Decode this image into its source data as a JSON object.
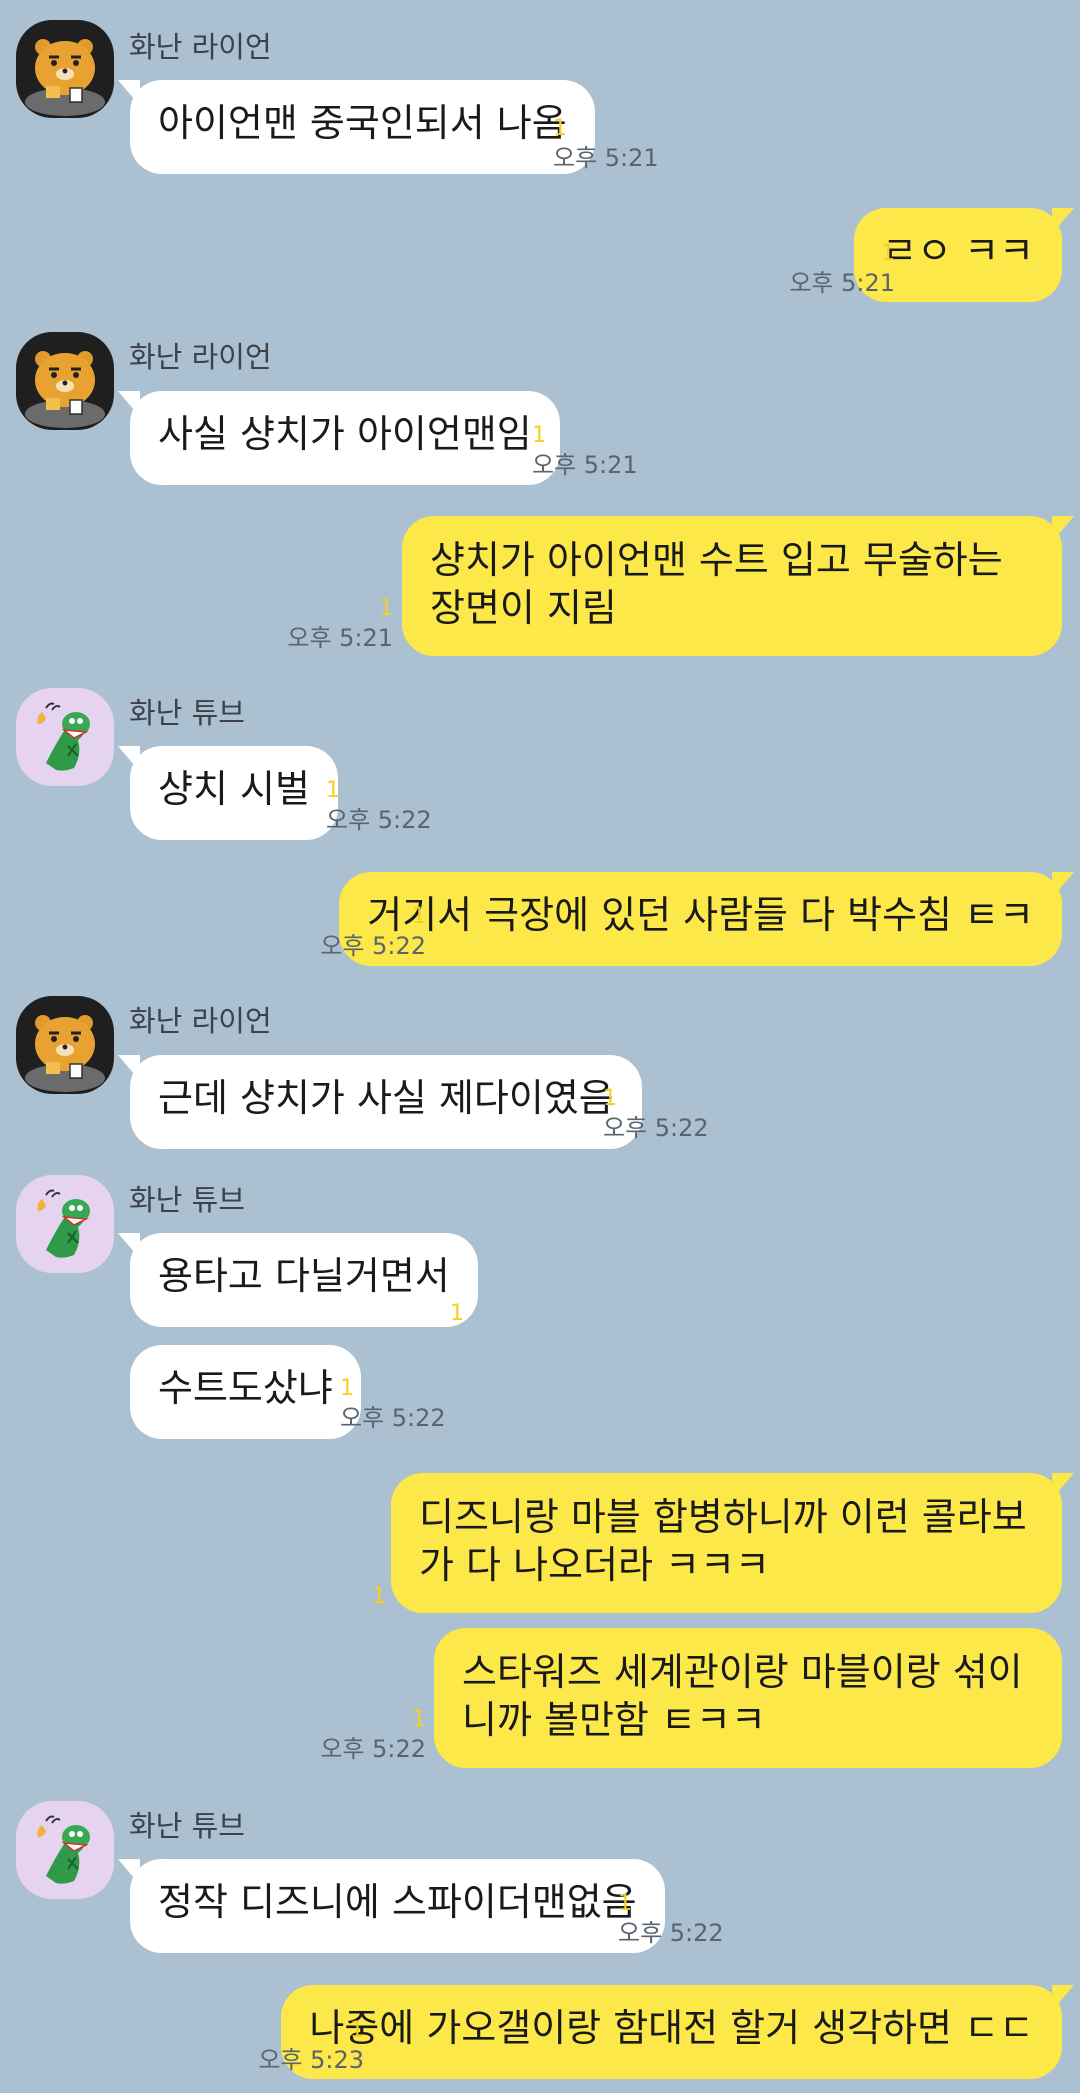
{
  "senders": {
    "ryan": "화난 라이언",
    "tube": "화난 튜브"
  },
  "messages": [
    {
      "text": "아이언맨 중국인되서 나옴",
      "unread": "1",
      "time": "오후 5:21"
    },
    {
      "text": "ㄹㅇ ㅋㅋ",
      "unread": "1",
      "time": "오후 5:21"
    },
    {
      "text": "사실 샹치가 아이언맨임",
      "unread": "1",
      "time": "오후 5:21"
    },
    {
      "text": "샹치가 아이언맨 수트 입고 무술하는 장면이 지림",
      "unread": "1",
      "time": "오후 5:21"
    },
    {
      "text": "샹치 시벌",
      "unread": "1",
      "time": "오후 5:22"
    },
    {
      "text": "거기서 극장에 있던 사람들 다 박수침 ㅌㅋ",
      "unread": "1",
      "time": "오후 5:22"
    },
    {
      "text": "근데 샹치가 사실 제다이였음",
      "unread": "1",
      "time": "오후 5:22"
    },
    {
      "text": "용타고 다닐거면서",
      "unread": "1",
      "time": ""
    },
    {
      "text": "수트도샀냐",
      "unread": "1",
      "time": "오후 5:22"
    },
    {
      "text": "디즈니랑 마블 합병하니까 이런 콜라보가 다 나오더라 ㅋㅋㅋ",
      "unread": "1",
      "time": ""
    },
    {
      "text": "스타워즈 세계관이랑 마블이랑 섞이니까 볼만함 ㅌㅋㅋ",
      "unread": "1",
      "time": "오후 5:22"
    },
    {
      "text": "정작 디즈니에 스파이더맨없음",
      "unread": "1",
      "time": "오후 5:22"
    },
    {
      "text": "나중에 가오갤이랑 함대전 할거 생각하면 ㄷㄷ",
      "unread": "1",
      "time": "오후 5:23"
    }
  ],
  "colors": {
    "background": "#abc1d1",
    "incoming_bubble": "#ffffff",
    "outgoing_bubble": "#fde84a",
    "unread_count": "#f6d01e"
  },
  "icons": {
    "ryan_avatar": "lion-character-icon",
    "tube_avatar": "crocodile-character-icon"
  }
}
